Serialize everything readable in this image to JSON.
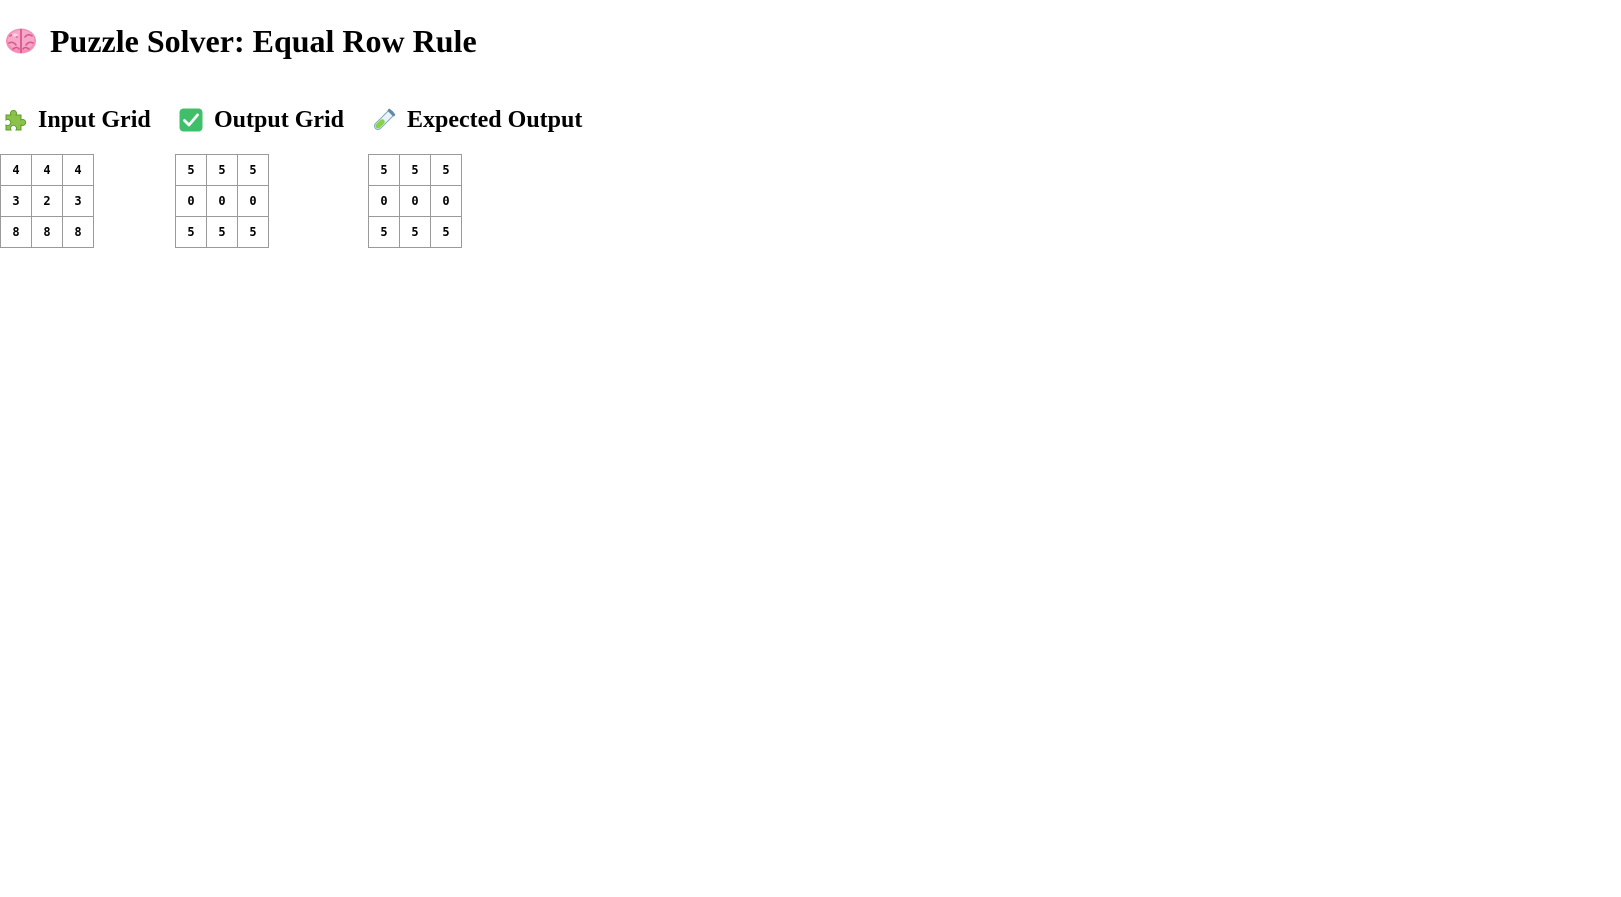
{
  "page": {
    "title": "Puzzle Solver: Equal Row Rule",
    "title_icon": "brain-icon"
  },
  "panels": [
    {
      "title": "Input Grid",
      "icon": "puzzle-piece-icon",
      "rows": [
        [
          "4",
          "4",
          "4"
        ],
        [
          "3",
          "2",
          "3"
        ],
        [
          "8",
          "8",
          "8"
        ]
      ]
    },
    {
      "title": "Output Grid",
      "icon": "check-mark-button-icon",
      "icon_color": "#3fbf6a",
      "rows": [
        [
          "5",
          "5",
          "5"
        ],
        [
          "0",
          "0",
          "0"
        ],
        [
          "5",
          "5",
          "5"
        ]
      ]
    },
    {
      "title": "Expected Output",
      "icon": "test-tube-icon",
      "rows": [
        [
          "5",
          "5",
          "5"
        ],
        [
          "0",
          "0",
          "0"
        ],
        [
          "5",
          "5",
          "5"
        ]
      ]
    }
  ]
}
